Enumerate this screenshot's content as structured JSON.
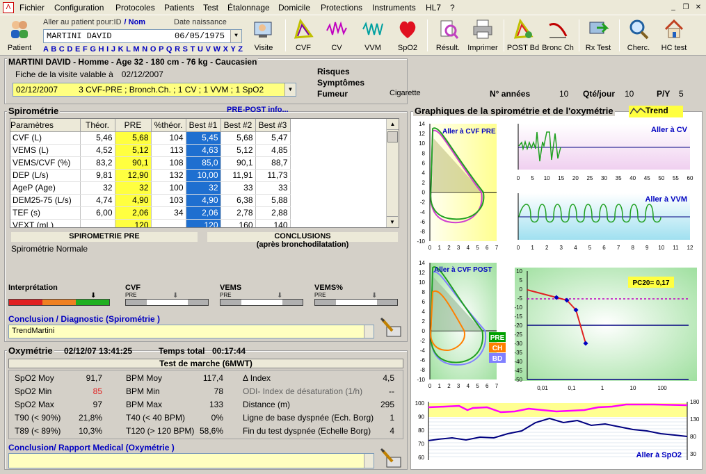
{
  "menu": [
    "Fichier",
    "Configuration",
    "Protocoles",
    "Patients",
    "Test",
    "Étalonnage",
    "Domicile",
    "Protections",
    "Instruments",
    "HL7",
    "?"
  ],
  "toolbar": {
    "patient": "Patient",
    "aller": "Aller au patient pour:ID",
    "nom": "/ Nom",
    "date_naissance": "Date naissance",
    "patient_name": "MARTINI DAVID",
    "birth": "06/05/1975",
    "alphabet": "A B C D E F G H I J K L M N O P Q R S T U V W X Y Z",
    "buttons": [
      "Visite",
      "CVF",
      "CV",
      "VVM",
      "SpO2",
      "Résult.",
      "Imprimer",
      "POST Bd",
      "Bronc Ch",
      "Rx Test",
      "Cherc.",
      "HC test"
    ]
  },
  "patient_header": "MARTINI DAVID - Homme - Age 32 - 180 cm - 76 kg - Caucasien",
  "visit": {
    "label": "Fiche de la visite valable à",
    "date": "02/12/2007",
    "select": "02/12/2007         3 CVF-PRE ; Bronch.Ch. ; 1 CV ; 1 VVM ; 1 SpO2"
  },
  "risks": {
    "risques": "Risques",
    "symptomes": "Symptômes",
    "fumeur": "Fumeur",
    "cigarette": "Cigarette",
    "n_annees": "N° années",
    "n_annees_val": "10",
    "qte": "Qté/jour",
    "qte_val": "10",
    "py": "P/Y",
    "py_val": "5"
  },
  "spiro": {
    "title": "Spirométrie",
    "prepost": "PRE-POST  info...",
    "headers": [
      "Paramètres",
      "Théor.",
      "PRE",
      "%théor.",
      "Best #1",
      "Best #2",
      "Best #3"
    ],
    "rows": [
      [
        "CVF (L)",
        "5,46",
        "5,68",
        "104",
        "5,45",
        "5,68",
        "5,47"
      ],
      [
        "VEMS (L)",
        "4,52",
        "5,12",
        "113",
        "4,63",
        "5,12",
        "4,85"
      ],
      [
        "VEMS/CVF (%)",
        "83,2",
        "90,1",
        "108",
        "85,0",
        "90,1",
        "88,7"
      ],
      [
        "DEP (L/s)",
        "9,81",
        "12,90",
        "132",
        "10,00",
        "11,91",
        "11,73"
      ],
      [
        "AgeP (Age)",
        "32",
        "32",
        "100",
        "32",
        "33",
        "33"
      ],
      [
        "DEM25-75 (L/s)",
        "4,74",
        "4,90",
        "103",
        "4,90",
        "6,38",
        "5,88"
      ],
      [
        "TEF (s)",
        "6,00",
        "2,06",
        "34",
        "2,06",
        "2,78",
        "2,88"
      ],
      [
        "VEXT (mL)",
        "",
        "120",
        "",
        "120",
        "160",
        "140"
      ]
    ],
    "pre_title": "SPIROMETRIE PRE",
    "conclusions": "CONCLUSIONS",
    "apres": "(après bronchodilatation)",
    "pre_text": "Spirométrie Normale",
    "interp": "Interprétation",
    "cvf": "CVF",
    "vems": "VEMS",
    "vems_pct": "VEMS%",
    "pre": "PRE",
    "conclusion_label": "Conclusion / Diagnostic (Spirométrie )",
    "conclusion_value": "TrendMartini"
  },
  "oxy": {
    "title": "Oxymétrie",
    "date": "02/12/07 13:41:25",
    "temps": "Temps total",
    "temps_val": "00:17:44",
    "test": "Test de marche (6MWT)",
    "c1": [
      [
        "SpO2 Moy",
        "91,7"
      ],
      [
        "SpO2 Min",
        "85"
      ],
      [
        "SpO2 Max",
        "97"
      ],
      [
        "T90 (< 90%)",
        "21,8%"
      ],
      [
        "T89 (< 89%)",
        "10,3%"
      ]
    ],
    "c2": [
      [
        "BPM Moy",
        "117,4"
      ],
      [
        "BPM Min",
        "78"
      ],
      [
        "BPM Max",
        "133"
      ],
      [
        "T40 (< 40 BPM)",
        "0%"
      ],
      [
        "T120 (> 120 BPM)",
        "58,6%"
      ]
    ],
    "c3": [
      [
        "Δ Index",
        "4,5"
      ],
      [
        "ODI- Index de désaturation (1/h)",
        "--"
      ],
      [
        "Distance (m)",
        "295"
      ],
      [
        "Ligne de base dyspnée (Ech. Borg)",
        "1"
      ],
      [
        "Fin du test dyspnée (Echelle Borg)",
        "4"
      ]
    ],
    "conclusion_label": "Conclusion/ Rapport Medical (Oxymétrie )"
  },
  "graphs": {
    "title": "Graphiques de la spirométrie et de l'oxymétrie",
    "trend": "Trend",
    "cvf_pre": "Aller à CVF PRE",
    "cv": "Aller à CV",
    "vvm": "Aller à VVM",
    "cvf_post": "Aller à CVF POST",
    "pc20": "PC20= 0,17",
    "spo2": "Aller à SpO2",
    "legend": [
      "PRE",
      "CH",
      "BD"
    ],
    "legend_colors": [
      "#00a000",
      "#ff8000",
      "#8080ff"
    ],
    "flow_y": [
      "14",
      "12",
      "10",
      "8",
      "6",
      "4",
      "2",
      "0",
      "-2",
      "-4",
      "-6",
      "-8",
      "-10"
    ],
    "flow_x": [
      "0",
      "1",
      "2",
      "3",
      "4",
      "5",
      "6",
      "7"
    ],
    "cv_x": [
      "0",
      "5",
      "10",
      "15",
      "20",
      "25",
      "30",
      "35",
      "40",
      "45",
      "50",
      "55",
      "60"
    ],
    "vvm_x": [
      "0",
      "1",
      "2",
      "3",
      "4",
      "5",
      "6",
      "7",
      "8",
      "9",
      "10",
      "11",
      "12"
    ],
    "pc_y": [
      "10",
      "5",
      "0",
      "-5",
      "-10",
      "-15",
      "-20",
      "-25",
      "-30",
      "-35",
      "-40",
      "-45",
      "-50"
    ],
    "pc_x": [
      "0,01",
      "0,1",
      "1",
      "10",
      "100"
    ],
    "spo2_y": [
      "100",
      "90",
      "80",
      "70",
      "60"
    ],
    "bpm_y": [
      "180",
      "130",
      "80",
      "30"
    ]
  }
}
